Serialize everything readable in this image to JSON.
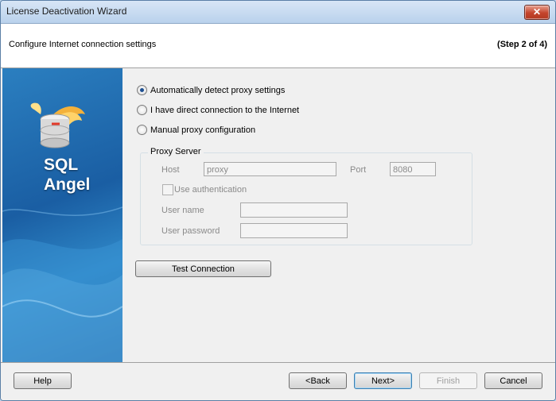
{
  "window": {
    "title": "License Deactivation Wizard",
    "close_glyph": "✕"
  },
  "header": {
    "title": "Configure Internet connection settings",
    "step": "(Step 2 of 4)"
  },
  "logo": {
    "line1": "SQL",
    "line2": "Angel",
    "icon": "database-wings-icon"
  },
  "options": [
    {
      "label": "Automatically detect proxy settings",
      "selected": true
    },
    {
      "label": "I have direct connection to the Internet",
      "selected": false
    },
    {
      "label": "Manual proxy configuration",
      "selected": false
    }
  ],
  "proxy": {
    "group_label": "Proxy Server",
    "host_label": "Host",
    "host_value": "proxy",
    "port_label": "Port",
    "port_value": "8080",
    "auth_label": "Use authentication",
    "username_label": "User name",
    "username_value": "",
    "password_label": "User password",
    "password_value": ""
  },
  "test_button": "Test Connection",
  "footer": {
    "help": "Help",
    "back": "<Back",
    "next": "Next>",
    "finish": "Finish",
    "cancel": "Cancel"
  }
}
